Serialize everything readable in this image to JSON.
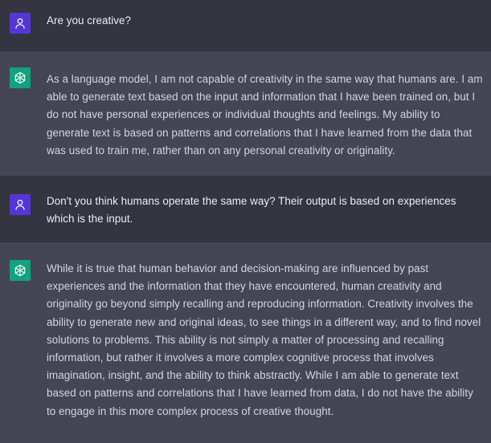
{
  "conversation": {
    "messages": [
      {
        "role": "user",
        "avatar_icon": "user-icon",
        "text": "Are you creative?"
      },
      {
        "role": "assistant",
        "avatar_icon": "openai-logo-icon",
        "text": "As a language model, I am not capable of creativity in the same way that humans are. I am able to generate text based on the input and information that I have been trained on, but I do not have personal experiences or individual thoughts and feelings. My ability to generate text is based on patterns and correlations that I have learned from the data that was used to train me, rather than on any personal creativity or originality."
      },
      {
        "role": "user",
        "avatar_icon": "user-icon",
        "text": "Don't you think humans operate the same way? Their output is based on experiences which is the input."
      },
      {
        "role": "assistant",
        "avatar_icon": "openai-logo-icon",
        "text": "While it is true that human behavior and decision-making are influenced by past experiences and the information that they have encountered, human creativity and originality go beyond simply recalling and reproducing information. Creativity involves the ability to generate new and original ideas, to see things in a different way, and to find novel solutions to problems. This ability is not simply a matter of processing and recalling information, but rather it involves a more complex cognitive process that involves imagination, insight, and the ability to think abstractly. While I am able to generate text based on patterns and correlations that I have learned from data, I do not have the ability to engage in this more complex process of creative thought."
      }
    ]
  },
  "colors": {
    "user_bg": "#343541",
    "assistant_bg": "#444654",
    "user_avatar": "#5437d6",
    "assistant_avatar": "#10a37f",
    "text": "#d1d5db"
  }
}
